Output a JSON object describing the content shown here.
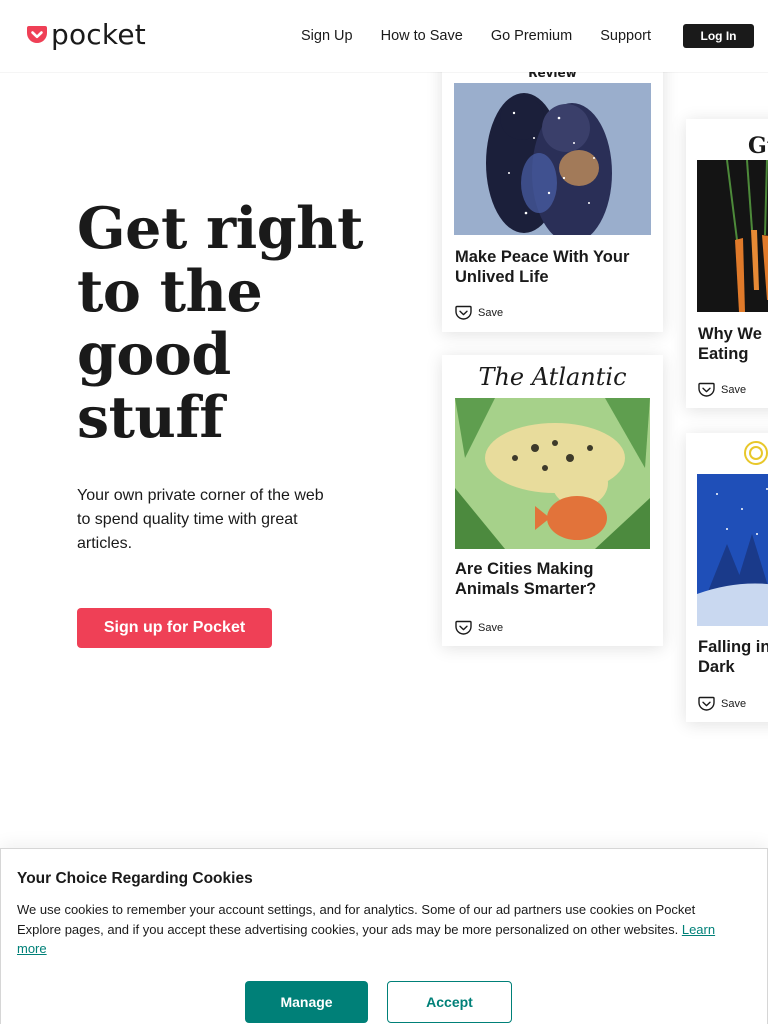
{
  "header": {
    "logo_text": "pocket",
    "nav": [
      "Sign Up",
      "How to Save",
      "Go Premium",
      "Support"
    ],
    "login_label": "Log In"
  },
  "hero": {
    "title_lines": [
      "Get right",
      "to the",
      "good",
      "stuff"
    ],
    "subtitle": "Your own private corner of the web to spend quality time with great articles.",
    "cta_label": "Sign up for Pocket"
  },
  "cards": [
    {
      "publication": "Review",
      "title": "Make Peace With Your Unlived Life",
      "save_label": "Save"
    },
    {
      "publication": "The Atlantic",
      "title": "Are Cities Making Animals Smarter?",
      "save_label": "Save"
    },
    {
      "publication": "Gu",
      "title": "Why We Eating",
      "title_lines": [
        "Why We",
        "Eating"
      ],
      "save_label": "Save"
    },
    {
      "publication": "",
      "title": "Falling in Dark",
      "title_lines": [
        "Falling in",
        "Dark"
      ],
      "save_label": "Save"
    }
  ],
  "cookie": {
    "title": "Your Choice Regarding Cookies",
    "text": "We use cookies to remember your account settings, and for analytics. Some of our ad partners use cookies on Pocket Explore pages, and if you accept these advertising cookies, your ads may be more personalized on other websites.",
    "link_label": "Learn more",
    "manage_label": "Manage",
    "accept_label": "Accept"
  },
  "colors": {
    "brand_red": "#ef4056",
    "teal": "#008078",
    "dark": "#1a1a1a"
  }
}
